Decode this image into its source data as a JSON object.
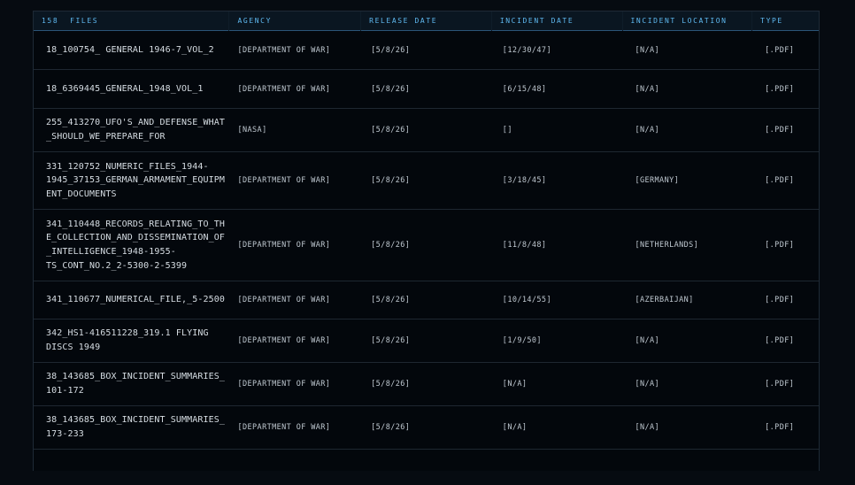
{
  "table": {
    "file_count": "158",
    "headers": {
      "files": "FILES",
      "agency": "AGENCY",
      "release_date": "RELEASE DATE",
      "incident_date": "INCIDENT DATE",
      "incident_location": "INCIDENT LOCATION",
      "type": "TYPE"
    },
    "rows": [
      {
        "name": "18_100754_ GENERAL 1946-7_VOL_2",
        "agency": "[DEPARTMENT OF WAR]",
        "release": "[5/8/26]",
        "incident": "[12/30/47]",
        "location": "[N/A]",
        "type": "[.PDF]"
      },
      {
        "name": "18_6369445_GENERAL_1948_VOL_1",
        "agency": "[DEPARTMENT OF WAR]",
        "release": "[5/8/26]",
        "incident": "[6/15/48]",
        "location": "[N/A]",
        "type": "[.PDF]"
      },
      {
        "name": "255_413270_UFO'S_AND_DEFENSE_WHAT\n_SHOULD_WE_PREPARE_FOR",
        "agency": "[NASA]",
        "release": "[5/8/26]",
        "incident": "[]",
        "location": "[N/A]",
        "type": "[.PDF]"
      },
      {
        "name": "331_120752_NUMERIC_FILES_1944-\n1945_37153_GERMAN_ARMAMENT_EQUIPM\nENT_DOCUMENTS",
        "agency": "[DEPARTMENT OF WAR]",
        "release": "[5/8/26]",
        "incident": "[3/18/45]",
        "location": "[GERMANY]",
        "type": "[.PDF]"
      },
      {
        "name": "341_110448_RECORDS_RELATING_TO_TH\nE_COLLECTION_AND_DISSEMINATION_OF\n_INTELLIGENCE_1948-1955-\nTS_CONT_NO.2_2-5300-2-5399",
        "agency": "[DEPARTMENT OF WAR]",
        "release": "[5/8/26]",
        "incident": "[11/8/48]",
        "location": "[NETHERLANDS]",
        "type": "[.PDF]"
      },
      {
        "name": "341_110677_NUMERICAL_FILE,_5-2500",
        "agency": "[DEPARTMENT OF WAR]",
        "release": "[5/8/26]",
        "incident": "[10/14/55]",
        "location": "[AZERBAIJAN]",
        "type": "[.PDF]"
      },
      {
        "name": "342_HS1-416511228_319.1 FLYING\nDISCS 1949",
        "agency": "[DEPARTMENT OF WAR]",
        "release": "[5/8/26]",
        "incident": "[1/9/50]",
        "location": "[N/A]",
        "type": "[.PDF]"
      },
      {
        "name": "38_143685_BOX_INCIDENT_SUMMARIES_\n101-172",
        "agency": "[DEPARTMENT OF WAR]",
        "release": "[5/8/26]",
        "incident": "[N/A]",
        "location": "[N/A]",
        "type": "[.PDF]"
      },
      {
        "name": "38_143685_BOX_INCIDENT_SUMMARIES_\n173-233",
        "agency": "[DEPARTMENT OF WAR]",
        "release": "[5/8/26]",
        "incident": "[N/A]",
        "location": "[N/A]",
        "type": "[.PDF]"
      },
      {
        "name": "",
        "agency": "",
        "release": "",
        "incident": "",
        "location": "",
        "type": ""
      }
    ]
  }
}
